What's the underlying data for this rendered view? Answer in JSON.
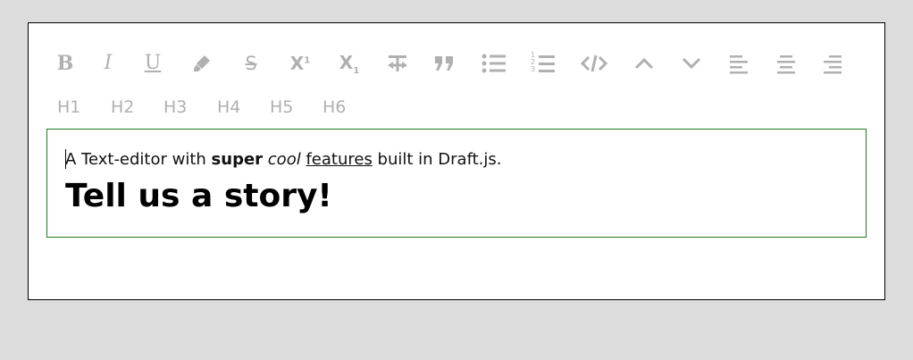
{
  "toolbar": {
    "buttons": [
      {
        "name": "bold",
        "glyph": "B"
      },
      {
        "name": "italic",
        "glyph": "I"
      },
      {
        "name": "underline",
        "glyph": "U"
      },
      {
        "name": "highlight",
        "glyph": "highlighter-icon"
      },
      {
        "name": "strikethrough",
        "glyph": "S"
      },
      {
        "name": "superscript",
        "glyph": "X"
      },
      {
        "name": "subscript",
        "glyph": "X"
      },
      {
        "name": "clear-format",
        "glyph": "T"
      },
      {
        "name": "blockquote",
        "glyph": "quote-icon"
      },
      {
        "name": "unordered-list",
        "glyph": "list-bullet-icon"
      },
      {
        "name": "ordered-list",
        "glyph": "list-number-icon"
      },
      {
        "name": "code",
        "glyph": "code-icon"
      },
      {
        "name": "chevron-up",
        "glyph": "chevron-up-icon"
      },
      {
        "name": "chevron-down",
        "glyph": "chevron-down-icon"
      },
      {
        "name": "align-left",
        "glyph": "align-left-icon"
      },
      {
        "name": "align-center",
        "glyph": "align-center-icon"
      },
      {
        "name": "align-right",
        "glyph": "align-right-icon"
      }
    ],
    "superscript_mark": "1",
    "subscript_mark": "1",
    "ordered_marks": [
      "1",
      "2",
      "3"
    ]
  },
  "headings": [
    "H1",
    "H2",
    "H3",
    "H4",
    "H5",
    "H6"
  ],
  "editor": {
    "line1": {
      "pre": "A Text-editor with ",
      "bold": "super",
      "italic": "cool",
      "underline": "features",
      "post": " built in Draft.js."
    },
    "headline": "Tell us a story!"
  },
  "colors": {
    "icon": "#b0b0b0",
    "editor_border": "#1f7a1f",
    "page_bg": "#dcdcdc",
    "frame_border": "#000000"
  }
}
